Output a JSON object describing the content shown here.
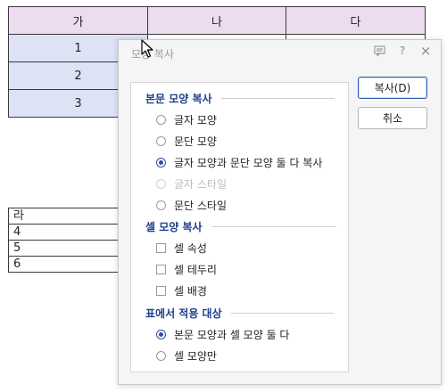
{
  "table1": {
    "headers": [
      "가",
      "나",
      "다"
    ],
    "rows": [
      [
        "1",
        "",
        ""
      ],
      [
        "2",
        "",
        ""
      ],
      [
        "3",
        "",
        ""
      ]
    ]
  },
  "table2": {
    "rows": [
      "라",
      "4",
      "5",
      "6"
    ]
  },
  "dialog": {
    "title": "모양 복사",
    "title_icons": [
      "comment-icon",
      "help-icon",
      "close-icon"
    ],
    "help_glyph": "?",
    "close_glyph": "×",
    "section_body": "본문 모양 복사",
    "body_options": [
      {
        "label": "글자 모양",
        "checked": false,
        "disabled": false
      },
      {
        "label": "문단 모양",
        "checked": false,
        "disabled": false
      },
      {
        "label": "글자 모양과 문단 모양 둘 다 복사",
        "checked": true,
        "disabled": false
      },
      {
        "label": "글자 스타일",
        "checked": false,
        "disabled": true
      },
      {
        "label": "문단 스타일",
        "checked": false,
        "disabled": false
      }
    ],
    "section_cell": "셀 모양 복사",
    "cell_options": [
      {
        "label": "셀 속성",
        "checked": false
      },
      {
        "label": "셀 테두리",
        "checked": false
      },
      {
        "label": "셀 배경",
        "checked": false
      }
    ],
    "section_apply": "표에서 적용 대상",
    "apply_options": [
      {
        "label": "본문 모양과 셀 모양 둘 다",
        "checked": true
      },
      {
        "label": "셀 모양만",
        "checked": false
      }
    ],
    "copy_button": "복사(D)",
    "cancel_button": "취소"
  },
  "colors": {
    "header_bg": "#eddcef",
    "first_col_bg": "#dde3f5",
    "accent": "#1e3f8c"
  }
}
